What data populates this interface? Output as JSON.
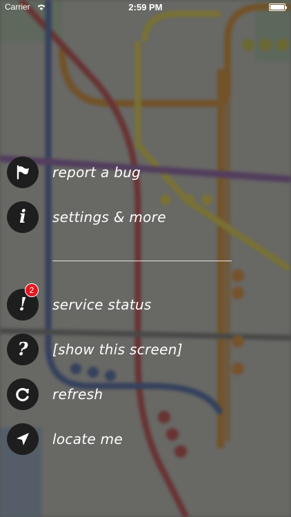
{
  "status_bar": {
    "carrier": "Carrier",
    "time": "2:59 PM"
  },
  "menu": {
    "items": [
      {
        "label": "report a bug",
        "icon": "flag-icon"
      },
      {
        "label": "settings & more",
        "icon": "info-icon",
        "glyph": "i"
      },
      {
        "label": "service status",
        "icon": "exclamation-icon",
        "glyph": "!",
        "badge": "2"
      },
      {
        "label": "[show this screen]",
        "icon": "question-icon",
        "glyph": "?"
      },
      {
        "label": "refresh",
        "icon": "refresh-icon"
      },
      {
        "label": "locate me",
        "icon": "location-arrow-icon"
      }
    ]
  },
  "colors": {
    "icon_bg": "#1e1e1e",
    "badge": "#e3171e",
    "text": "#ffffff"
  }
}
